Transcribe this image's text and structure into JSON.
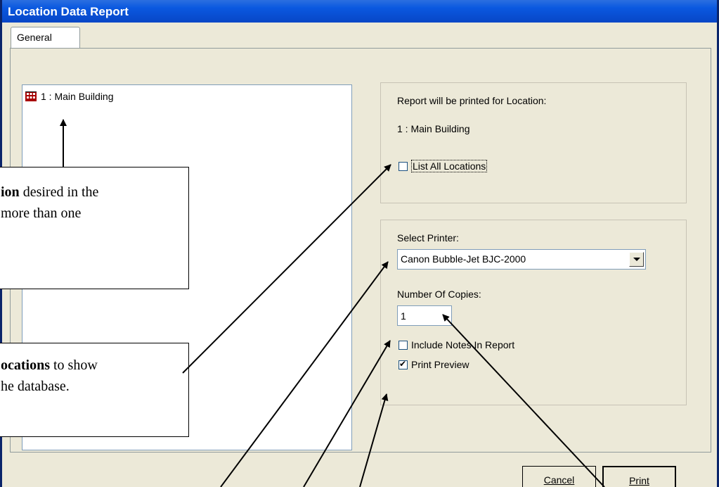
{
  "window": {
    "title": "Location Data Report"
  },
  "tabs": [
    {
      "label": "General"
    }
  ],
  "tree": {
    "items": [
      {
        "label": "1 : Main Building",
        "icon": "building-icon"
      }
    ]
  },
  "location_group": {
    "heading": "Report will be printed for Location:",
    "location": "1 : Main Building",
    "list_all": {
      "label": "List All Locations",
      "checked": false
    }
  },
  "print_group": {
    "printer_label": "Select Printer:",
    "printer_value": "Canon Bubble-Jet BJC-2000",
    "copies_label": "Number Of Copies:",
    "copies_value": "1",
    "include_notes": {
      "label": "Include Notes In Report",
      "checked": false
    },
    "print_preview": {
      "label": "Print Preview",
      "checked": true
    }
  },
  "buttons": {
    "cancel": "Cancel",
    "print": "Print"
  },
  "callouts": {
    "c1_bold": "ion",
    "c1_line1": " desired in the",
    "c1_line2": "more than one",
    "c2_bold": "ocations",
    "c2_line1": " to show",
    "c2_line2": "he database."
  },
  "colors": {
    "titlebar": "#0a58e0",
    "face": "#ece9d8",
    "border": "#0a246a"
  }
}
